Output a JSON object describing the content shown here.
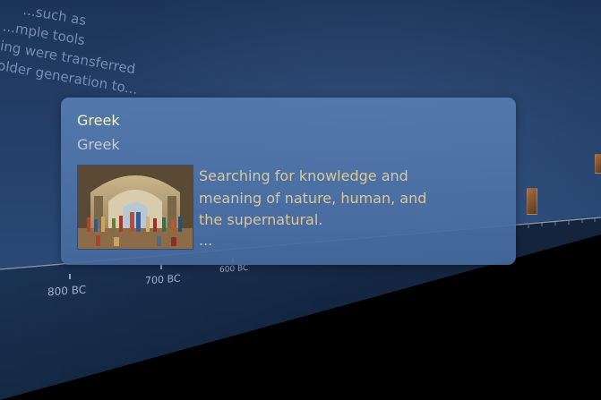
{
  "background_text": {
    "lines": [
      "...such as",
      "...mple tools",
      "...ing were transferred",
      "...older generation to..."
    ]
  },
  "timeline": {
    "labels": [
      "800 BC",
      "700 BC",
      "600 BC"
    ]
  },
  "card": {
    "title": "Greek",
    "subtitle": "Greek",
    "description": "Searching for knowledge and meaning of nature, human, and the supernatural.",
    "more": "...",
    "image_icon": "school-of-athens-painting-icon"
  },
  "colors": {
    "card_bg": "#5a7cb0",
    "title": "#f2f3c0",
    "subtitle": "#c2cbd8",
    "description": "#d8c89c",
    "wall": "#24406a"
  }
}
